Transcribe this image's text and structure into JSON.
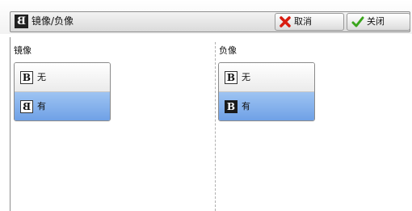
{
  "title": {
    "text": "镜像/负像"
  },
  "buttons": {
    "cancel": "取消",
    "close": "关闭"
  },
  "mirror": {
    "label": "镜像",
    "options": [
      "无",
      "有"
    ],
    "selected": "有"
  },
  "negative": {
    "label": "负像",
    "options": [
      "无",
      "有"
    ],
    "selected": "有"
  },
  "icons": {
    "title": "mirror-b-icon",
    "cancel": "red-x-icon",
    "close": "green-check-icon",
    "b_normal": "b-icon",
    "b_mirror": "mirrored-b-icon",
    "b_negative": "negative-b-icon"
  },
  "colors": {
    "selected_bg": "#8ab3ee",
    "cancel_icon": "#d81c10",
    "close_icon": "#3aa51c"
  }
}
